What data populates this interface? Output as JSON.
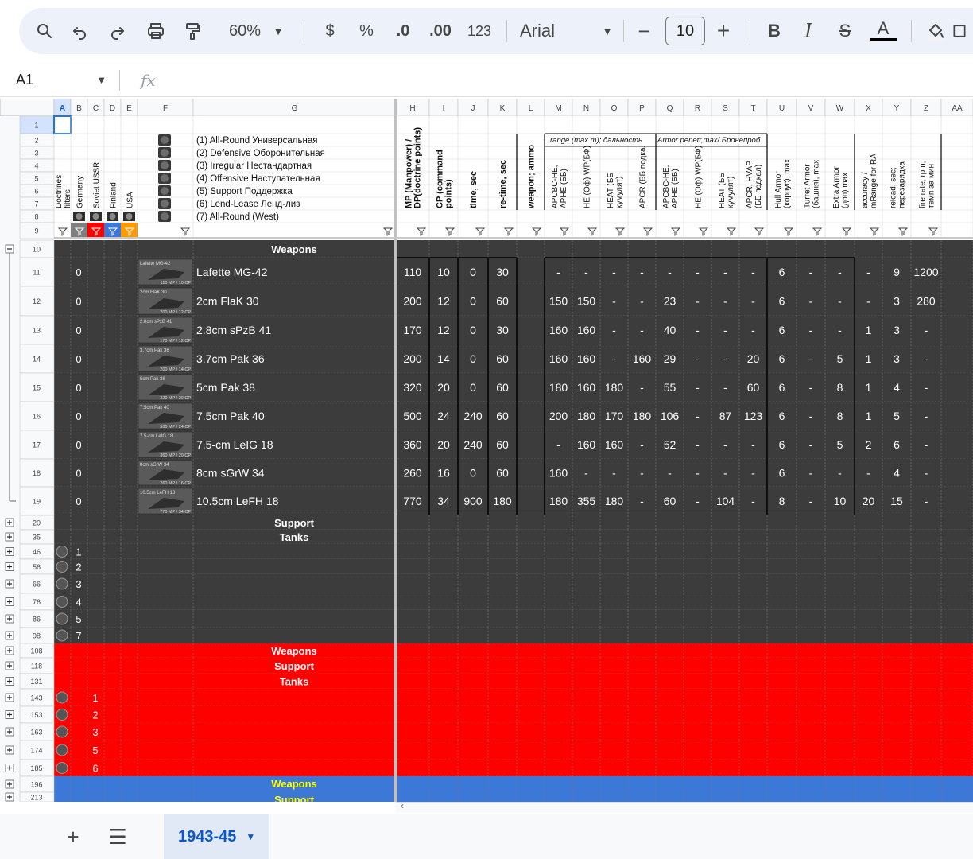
{
  "toolbar": {
    "zoom": "60%",
    "currency": "$",
    "percent": "%",
    "dec_dec": ".0",
    "inc_dec": ".00",
    "number_fmt": "123",
    "font": "Arial",
    "font_size": "10",
    "bold": "B",
    "italic": "I",
    "strike": "S",
    "textcolor": "A"
  },
  "formula": {
    "cell_ref": "A1",
    "fx": "fx"
  },
  "columns": [
    "A",
    "B",
    "C",
    "D",
    "E",
    "F",
    "G",
    "H",
    "I",
    "J",
    "K",
    "L",
    "M",
    "N",
    "O",
    "P",
    "Q",
    "R",
    "S",
    "T",
    "U",
    "V",
    "W",
    "X",
    "Y",
    "Z",
    "AA"
  ],
  "doctrines": [
    "(1) All-Round Универсальная",
    "(2) Defensive Оборонительная",
    "(3) Irregular Нестандартная",
    "(4) Offensive Наступательная",
    "(5) Support Поддержка",
    "(6) Lend-Lease Ленд-лиз",
    "(7) All-Round (West)"
  ],
  "rot_headers": {
    "A": "Doctrines filters",
    "B": "Germany",
    "C": "Soviet USSR",
    "D": "Finland",
    "E": "USA",
    "H": "MP (Manpower) / DP(doctrine points)",
    "I": "CP (command points)",
    "J": "time, sec",
    "K": "re-time, sec",
    "L": "weapon; ammo",
    "M": "APCBC-HE, APHE (ББ)",
    "N": "HE (Оф) WP(БФ)",
    "O": "HEAT (ББ кумулят)",
    "P": "APCR (ББ подкал)",
    "Q": "APCBC-HE, APHE (ББ)",
    "R": "HE (Оф) WP(БФ)",
    "S": "HEAT (ББ кумулят)",
    "T": "APCR, HVAP (ББ подкал)",
    "U": "Hull Armor (корпус), max",
    "V": "Turret Armor (башня), max",
    "W": "Extra Armor (доп) max",
    "X": "accuracy / mRange for RA",
    "Y": "reload, sec; перезарядка",
    "Z": "fire rate, rpm; темп за мин"
  },
  "group_headers": {
    "range": "range (max m); дальность",
    "armor": "Armor penetr,max/ Бронепроб."
  },
  "weapons_title": "Weapons",
  "support_title": "Support",
  "tanks_title": "Tanks",
  "weapons": [
    {
      "row": "11",
      "b": "0",
      "img": "Lafette MG-42",
      "img2": "110 MP / 10 CP",
      "name": "Lafette MG-42",
      "vals": [
        "110",
        "10",
        "0",
        "30",
        "",
        "-",
        "-",
        "-",
        "-",
        "-",
        "-",
        "-",
        "-",
        "6",
        "-",
        "-",
        "-",
        "9",
        "1200",
        ""
      ]
    },
    {
      "row": "12",
      "b": "0",
      "img": "2cm FlaK 30",
      "img2": "200 MP / 12 CP",
      "name": "2cm FlaK 30",
      "vals": [
        "200",
        "12",
        "0",
        "60",
        "",
        "150",
        "150",
        "-",
        "-",
        "23",
        "-",
        "-",
        "-",
        "6",
        "-",
        "-",
        "-",
        "3",
        "280",
        ""
      ]
    },
    {
      "row": "13",
      "b": "0",
      "img": "2.8cm sPzB 41",
      "img2": "170 MP / 12 CP",
      "name": "2.8cm sPzB 41",
      "vals": [
        "170",
        "12",
        "0",
        "30",
        "",
        "160",
        "160",
        "-",
        "-",
        "40",
        "-",
        "-",
        "-",
        "6",
        "-",
        "-",
        "1",
        "3",
        "-",
        ""
      ]
    },
    {
      "row": "14",
      "b": "0",
      "img": "3.7cm Pak 36",
      "img2": "200 MP / 14 CP",
      "name": "3.7cm Pak 36",
      "vals": [
        "200",
        "14",
        "0",
        "60",
        "",
        "160",
        "160",
        "-",
        "160",
        "29",
        "-",
        "-",
        "20",
        "6",
        "-",
        "5",
        "1",
        "3",
        "-",
        ""
      ]
    },
    {
      "row": "15",
      "b": "0",
      "img": "5cm Pak 38",
      "img2": "320 MP / 20 CP",
      "name": "5cm Pak 38",
      "vals": [
        "320",
        "20",
        "0",
        "60",
        "",
        "180",
        "160",
        "180",
        "-",
        "55",
        "-",
        "-",
        "60",
        "6",
        "-",
        "8",
        "1",
        "4",
        "-",
        ""
      ]
    },
    {
      "row": "16",
      "b": "0",
      "img": "7.5cm Pak 40",
      "img2": "500 MP / 24 CP",
      "name": "7.5cm Pak 40",
      "vals": [
        "500",
        "24",
        "240",
        "60",
        "",
        "200",
        "180",
        "170",
        "180",
        "106",
        "-",
        "87",
        "123",
        "6",
        "-",
        "8",
        "1",
        "5",
        "-",
        ""
      ]
    },
    {
      "row": "17",
      "b": "0",
      "img": "7.5-cm LeIG 18",
      "img2": "360 MP / 20 CP",
      "name": "7.5-cm LeIG 18",
      "vals": [
        "360",
        "20",
        "240",
        "60",
        "",
        "-",
        "160",
        "160",
        "-",
        "52",
        "-",
        "-",
        "-",
        "6",
        "-",
        "5",
        "2",
        "6",
        "-",
        ""
      ]
    },
    {
      "row": "18",
      "b": "0",
      "img": "8cm sGrW 34",
      "img2": "260 MP / 16 CP",
      "name": "8cm sGrW 34",
      "vals": [
        "260",
        "16",
        "0",
        "60",
        "",
        "160",
        "-",
        "-",
        "-",
        "-",
        "-",
        "-",
        "-",
        "6",
        "-",
        "-",
        "-",
        "4",
        "-",
        ""
      ]
    },
    {
      "row": "19",
      "b": "0",
      "img": "10.5cm LeFH 18",
      "img2": "770 MP / 34 CP",
      "name": "10.5cm LeFH 18",
      "vals": [
        "770",
        "34",
        "900",
        "180",
        "",
        "180",
        "355",
        "180",
        "-",
        "60",
        "-",
        "104",
        "-",
        "8",
        "-",
        "10",
        "20",
        "15",
        "-",
        ""
      ]
    }
  ],
  "grey_rows": [
    {
      "row": "20",
      "title": "Support"
    },
    {
      "row": "35",
      "title": "Tanks"
    },
    {
      "row": "46",
      "num": "1"
    },
    {
      "row": "56",
      "num": "2"
    },
    {
      "row": "66",
      "num": "3"
    },
    {
      "row": "76",
      "num": "4"
    },
    {
      "row": "86",
      "num": "5"
    },
    {
      "row": "98",
      "num": "7"
    }
  ],
  "red_rows": [
    {
      "row": "108",
      "title": "Weapons"
    },
    {
      "row": "118",
      "title": "Support"
    },
    {
      "row": "131",
      "title": "Tanks"
    },
    {
      "row": "143",
      "num": "1"
    },
    {
      "row": "153",
      "num": "2"
    },
    {
      "row": "163",
      "num": "3"
    },
    {
      "row": "174",
      "num": "5"
    },
    {
      "row": "185",
      "num": "6"
    }
  ],
  "blue_rows": [
    {
      "row": "196",
      "title": "Weapons"
    },
    {
      "row": "213",
      "title": "Support"
    }
  ],
  "sheet": {
    "name": "1943-45"
  },
  "colors": {
    "grey": "#3c3c3c",
    "red": "#ff0000",
    "blue": "#3c78d8",
    "yellow": "#ffff00",
    "header_sel": "#d3e3fd",
    "grid": "#c0c0c0"
  }
}
